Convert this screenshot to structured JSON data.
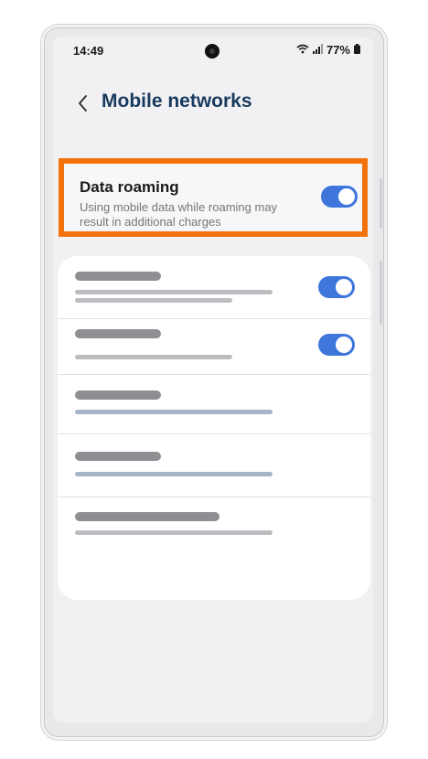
{
  "status_bar": {
    "time": "14:49",
    "battery": "77%",
    "icons": [
      "wifi-icon",
      "signal-icon",
      "battery-icon"
    ]
  },
  "header": {
    "back_icon": "chevron-left-icon",
    "title": "Mobile networks"
  },
  "data_roaming": {
    "label": "Data roaming",
    "description": "Using mobile data while roaming may result in additional charges",
    "enabled": true,
    "highlight_color": "#f4720d"
  },
  "placeholder_rows": [
    {
      "toggle": true,
      "toggle_on": true
    },
    {
      "toggle": true,
      "toggle_on": true
    },
    {
      "toggle": false
    },
    {
      "toggle": false
    },
    {
      "toggle": false
    }
  ],
  "colors": {
    "accent": "#3e76dc",
    "title": "#193a5f",
    "highlight": "#f4720d"
  }
}
